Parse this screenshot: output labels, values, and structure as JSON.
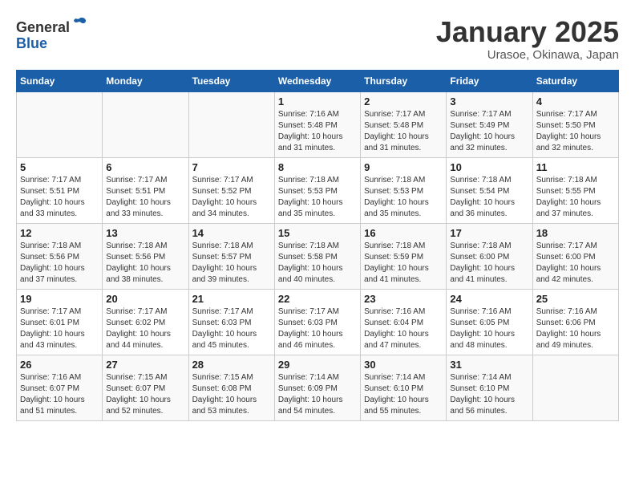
{
  "header": {
    "logo_line1": "General",
    "logo_line2": "Blue",
    "month_title": "January 2025",
    "location": "Urasoe, Okinawa, Japan"
  },
  "days_of_week": [
    "Sunday",
    "Monday",
    "Tuesday",
    "Wednesday",
    "Thursday",
    "Friday",
    "Saturday"
  ],
  "weeks": [
    [
      {
        "day": "",
        "sunrise": "",
        "sunset": "",
        "daylight": ""
      },
      {
        "day": "",
        "sunrise": "",
        "sunset": "",
        "daylight": ""
      },
      {
        "day": "",
        "sunrise": "",
        "sunset": "",
        "daylight": ""
      },
      {
        "day": "1",
        "sunrise": "Sunrise: 7:16 AM",
        "sunset": "Sunset: 5:48 PM",
        "daylight": "Daylight: 10 hours and 31 minutes."
      },
      {
        "day": "2",
        "sunrise": "Sunrise: 7:17 AM",
        "sunset": "Sunset: 5:48 PM",
        "daylight": "Daylight: 10 hours and 31 minutes."
      },
      {
        "day": "3",
        "sunrise": "Sunrise: 7:17 AM",
        "sunset": "Sunset: 5:49 PM",
        "daylight": "Daylight: 10 hours and 32 minutes."
      },
      {
        "day": "4",
        "sunrise": "Sunrise: 7:17 AM",
        "sunset": "Sunset: 5:50 PM",
        "daylight": "Daylight: 10 hours and 32 minutes."
      }
    ],
    [
      {
        "day": "5",
        "sunrise": "Sunrise: 7:17 AM",
        "sunset": "Sunset: 5:51 PM",
        "daylight": "Daylight: 10 hours and 33 minutes."
      },
      {
        "day": "6",
        "sunrise": "Sunrise: 7:17 AM",
        "sunset": "Sunset: 5:51 PM",
        "daylight": "Daylight: 10 hours and 33 minutes."
      },
      {
        "day": "7",
        "sunrise": "Sunrise: 7:17 AM",
        "sunset": "Sunset: 5:52 PM",
        "daylight": "Daylight: 10 hours and 34 minutes."
      },
      {
        "day": "8",
        "sunrise": "Sunrise: 7:18 AM",
        "sunset": "Sunset: 5:53 PM",
        "daylight": "Daylight: 10 hours and 35 minutes."
      },
      {
        "day": "9",
        "sunrise": "Sunrise: 7:18 AM",
        "sunset": "Sunset: 5:53 PM",
        "daylight": "Daylight: 10 hours and 35 minutes."
      },
      {
        "day": "10",
        "sunrise": "Sunrise: 7:18 AM",
        "sunset": "Sunset: 5:54 PM",
        "daylight": "Daylight: 10 hours and 36 minutes."
      },
      {
        "day": "11",
        "sunrise": "Sunrise: 7:18 AM",
        "sunset": "Sunset: 5:55 PM",
        "daylight": "Daylight: 10 hours and 37 minutes."
      }
    ],
    [
      {
        "day": "12",
        "sunrise": "Sunrise: 7:18 AM",
        "sunset": "Sunset: 5:56 PM",
        "daylight": "Daylight: 10 hours and 37 minutes."
      },
      {
        "day": "13",
        "sunrise": "Sunrise: 7:18 AM",
        "sunset": "Sunset: 5:56 PM",
        "daylight": "Daylight: 10 hours and 38 minutes."
      },
      {
        "day": "14",
        "sunrise": "Sunrise: 7:18 AM",
        "sunset": "Sunset: 5:57 PM",
        "daylight": "Daylight: 10 hours and 39 minutes."
      },
      {
        "day": "15",
        "sunrise": "Sunrise: 7:18 AM",
        "sunset": "Sunset: 5:58 PM",
        "daylight": "Daylight: 10 hours and 40 minutes."
      },
      {
        "day": "16",
        "sunrise": "Sunrise: 7:18 AM",
        "sunset": "Sunset: 5:59 PM",
        "daylight": "Daylight: 10 hours and 41 minutes."
      },
      {
        "day": "17",
        "sunrise": "Sunrise: 7:18 AM",
        "sunset": "Sunset: 6:00 PM",
        "daylight": "Daylight: 10 hours and 41 minutes."
      },
      {
        "day": "18",
        "sunrise": "Sunrise: 7:17 AM",
        "sunset": "Sunset: 6:00 PM",
        "daylight": "Daylight: 10 hours and 42 minutes."
      }
    ],
    [
      {
        "day": "19",
        "sunrise": "Sunrise: 7:17 AM",
        "sunset": "Sunset: 6:01 PM",
        "daylight": "Daylight: 10 hours and 43 minutes."
      },
      {
        "day": "20",
        "sunrise": "Sunrise: 7:17 AM",
        "sunset": "Sunset: 6:02 PM",
        "daylight": "Daylight: 10 hours and 44 minutes."
      },
      {
        "day": "21",
        "sunrise": "Sunrise: 7:17 AM",
        "sunset": "Sunset: 6:03 PM",
        "daylight": "Daylight: 10 hours and 45 minutes."
      },
      {
        "day": "22",
        "sunrise": "Sunrise: 7:17 AM",
        "sunset": "Sunset: 6:03 PM",
        "daylight": "Daylight: 10 hours and 46 minutes."
      },
      {
        "day": "23",
        "sunrise": "Sunrise: 7:16 AM",
        "sunset": "Sunset: 6:04 PM",
        "daylight": "Daylight: 10 hours and 47 minutes."
      },
      {
        "day": "24",
        "sunrise": "Sunrise: 7:16 AM",
        "sunset": "Sunset: 6:05 PM",
        "daylight": "Daylight: 10 hours and 48 minutes."
      },
      {
        "day": "25",
        "sunrise": "Sunrise: 7:16 AM",
        "sunset": "Sunset: 6:06 PM",
        "daylight": "Daylight: 10 hours and 49 minutes."
      }
    ],
    [
      {
        "day": "26",
        "sunrise": "Sunrise: 7:16 AM",
        "sunset": "Sunset: 6:07 PM",
        "daylight": "Daylight: 10 hours and 51 minutes."
      },
      {
        "day": "27",
        "sunrise": "Sunrise: 7:15 AM",
        "sunset": "Sunset: 6:07 PM",
        "daylight": "Daylight: 10 hours and 52 minutes."
      },
      {
        "day": "28",
        "sunrise": "Sunrise: 7:15 AM",
        "sunset": "Sunset: 6:08 PM",
        "daylight": "Daylight: 10 hours and 53 minutes."
      },
      {
        "day": "29",
        "sunrise": "Sunrise: 7:14 AM",
        "sunset": "Sunset: 6:09 PM",
        "daylight": "Daylight: 10 hours and 54 minutes."
      },
      {
        "day": "30",
        "sunrise": "Sunrise: 7:14 AM",
        "sunset": "Sunset: 6:10 PM",
        "daylight": "Daylight: 10 hours and 55 minutes."
      },
      {
        "day": "31",
        "sunrise": "Sunrise: 7:14 AM",
        "sunset": "Sunset: 6:10 PM",
        "daylight": "Daylight: 10 hours and 56 minutes."
      },
      {
        "day": "",
        "sunrise": "",
        "sunset": "",
        "daylight": ""
      }
    ]
  ]
}
